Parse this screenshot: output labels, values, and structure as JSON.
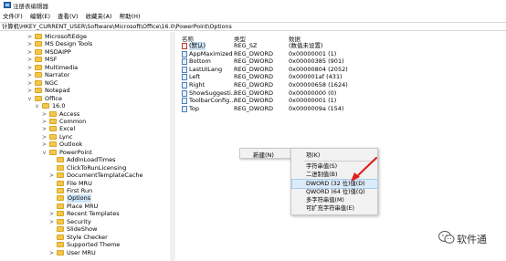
{
  "window": {
    "title": "注册表编辑器"
  },
  "menu": [
    "文件(F)",
    "编辑(E)",
    "查看(V)",
    "收藏夹(A)",
    "帮助(H)"
  ],
  "address": "计算机\\HKEY_CURRENT_USER\\Software\\Microsoft\\Office\\16.0\\PowerPoint\\Options",
  "tree": [
    {
      "label": "MicrosoftEdge",
      "level": 0,
      "chev": ">"
    },
    {
      "label": "MS Design Tools",
      "level": 0,
      "chev": ">"
    },
    {
      "label": "MSDAIPP",
      "level": 0,
      "chev": ">"
    },
    {
      "label": "MSF",
      "level": 0,
      "chev": ">"
    },
    {
      "label": "Multimedia",
      "level": 0,
      "chev": ">"
    },
    {
      "label": "Narrator",
      "level": 0,
      "chev": ">"
    },
    {
      "label": "NGC",
      "level": 0,
      "chev": ">"
    },
    {
      "label": "Notepad",
      "level": 0,
      "chev": ">"
    },
    {
      "label": "Office",
      "level": 0,
      "chev": "v"
    },
    {
      "label": "16.0",
      "level": 1,
      "chev": "v"
    },
    {
      "label": "Access",
      "level": 2,
      "chev": ">"
    },
    {
      "label": "Common",
      "level": 2,
      "chev": ">"
    },
    {
      "label": "Excel",
      "level": 2,
      "chev": ">"
    },
    {
      "label": "Lync",
      "level": 2,
      "chev": ">"
    },
    {
      "label": "Outlook",
      "level": 2,
      "chev": ">"
    },
    {
      "label": "PowerPoint",
      "level": 2,
      "chev": "v"
    },
    {
      "label": "AddInLoadTimes",
      "level": 3,
      "chev": ""
    },
    {
      "label": "ClickToRunLicensing",
      "level": 3,
      "chev": ""
    },
    {
      "label": "DocumentTemplateCache",
      "level": 3,
      "chev": ">"
    },
    {
      "label": "File MRU",
      "level": 3,
      "chev": ""
    },
    {
      "label": "First Run",
      "level": 3,
      "chev": ""
    },
    {
      "label": "Options",
      "level": 3,
      "chev": "",
      "selected": true
    },
    {
      "label": "Place MRU",
      "level": 3,
      "chev": ""
    },
    {
      "label": "Recent Templates",
      "level": 3,
      "chev": ">"
    },
    {
      "label": "Security",
      "level": 3,
      "chev": ">"
    },
    {
      "label": "SlideShow",
      "level": 3,
      "chev": ""
    },
    {
      "label": "Style Checker",
      "level": 3,
      "chev": ""
    },
    {
      "label": "Supported Theme",
      "level": 3,
      "chev": ""
    },
    {
      "label": "User MRU",
      "level": 3,
      "chev": ">"
    }
  ],
  "list": {
    "headers": {
      "name": "名称",
      "type": "类型",
      "data": "数据"
    },
    "rows": [
      {
        "name": "(默认)",
        "type": "REG_SZ",
        "data": "(数值未设置)",
        "icon": "ab"
      },
      {
        "name": "AppMaximized",
        "type": "REG_DWORD",
        "data": "0x00000001 (1)",
        "icon": "bin"
      },
      {
        "name": "Bottom",
        "type": "REG_DWORD",
        "data": "0x00000385 (901)",
        "icon": "bin"
      },
      {
        "name": "LastUILang",
        "type": "REG_DWORD",
        "data": "0x00000804 (2052)",
        "icon": "bin"
      },
      {
        "name": "Left",
        "type": "REG_DWORD",
        "data": "0x000001af (431)",
        "icon": "bin"
      },
      {
        "name": "Right",
        "type": "REG_DWORD",
        "data": "0x00000658 (1624)",
        "icon": "bin"
      },
      {
        "name": "ShowSuggesti...",
        "type": "REG_DWORD",
        "data": "0x00000000 (0)",
        "icon": "bin"
      },
      {
        "name": "ToolbarConfig...",
        "type": "REG_DWORD",
        "data": "0x00000001 (1)",
        "icon": "bin"
      },
      {
        "name": "Top",
        "type": "REG_DWORD",
        "data": "0x0000009a (154)",
        "icon": "bin"
      }
    ]
  },
  "context_menu": {
    "new_label": "新建(N)",
    "arrow": "›",
    "items": [
      "项(K)",
      "字符串值(S)",
      "二进制值(B)",
      "DWORD (32 位)值(D)",
      "QWORD (64 位)值(Q)",
      "多字符串值(M)",
      "可扩充字符串值(E)"
    ],
    "highlighted_index": 3
  },
  "watermark": {
    "text": "软件通"
  },
  "colors": {
    "selection": "#cce4f7",
    "folder": "#f3c74e",
    "arrow": "#e02020"
  }
}
